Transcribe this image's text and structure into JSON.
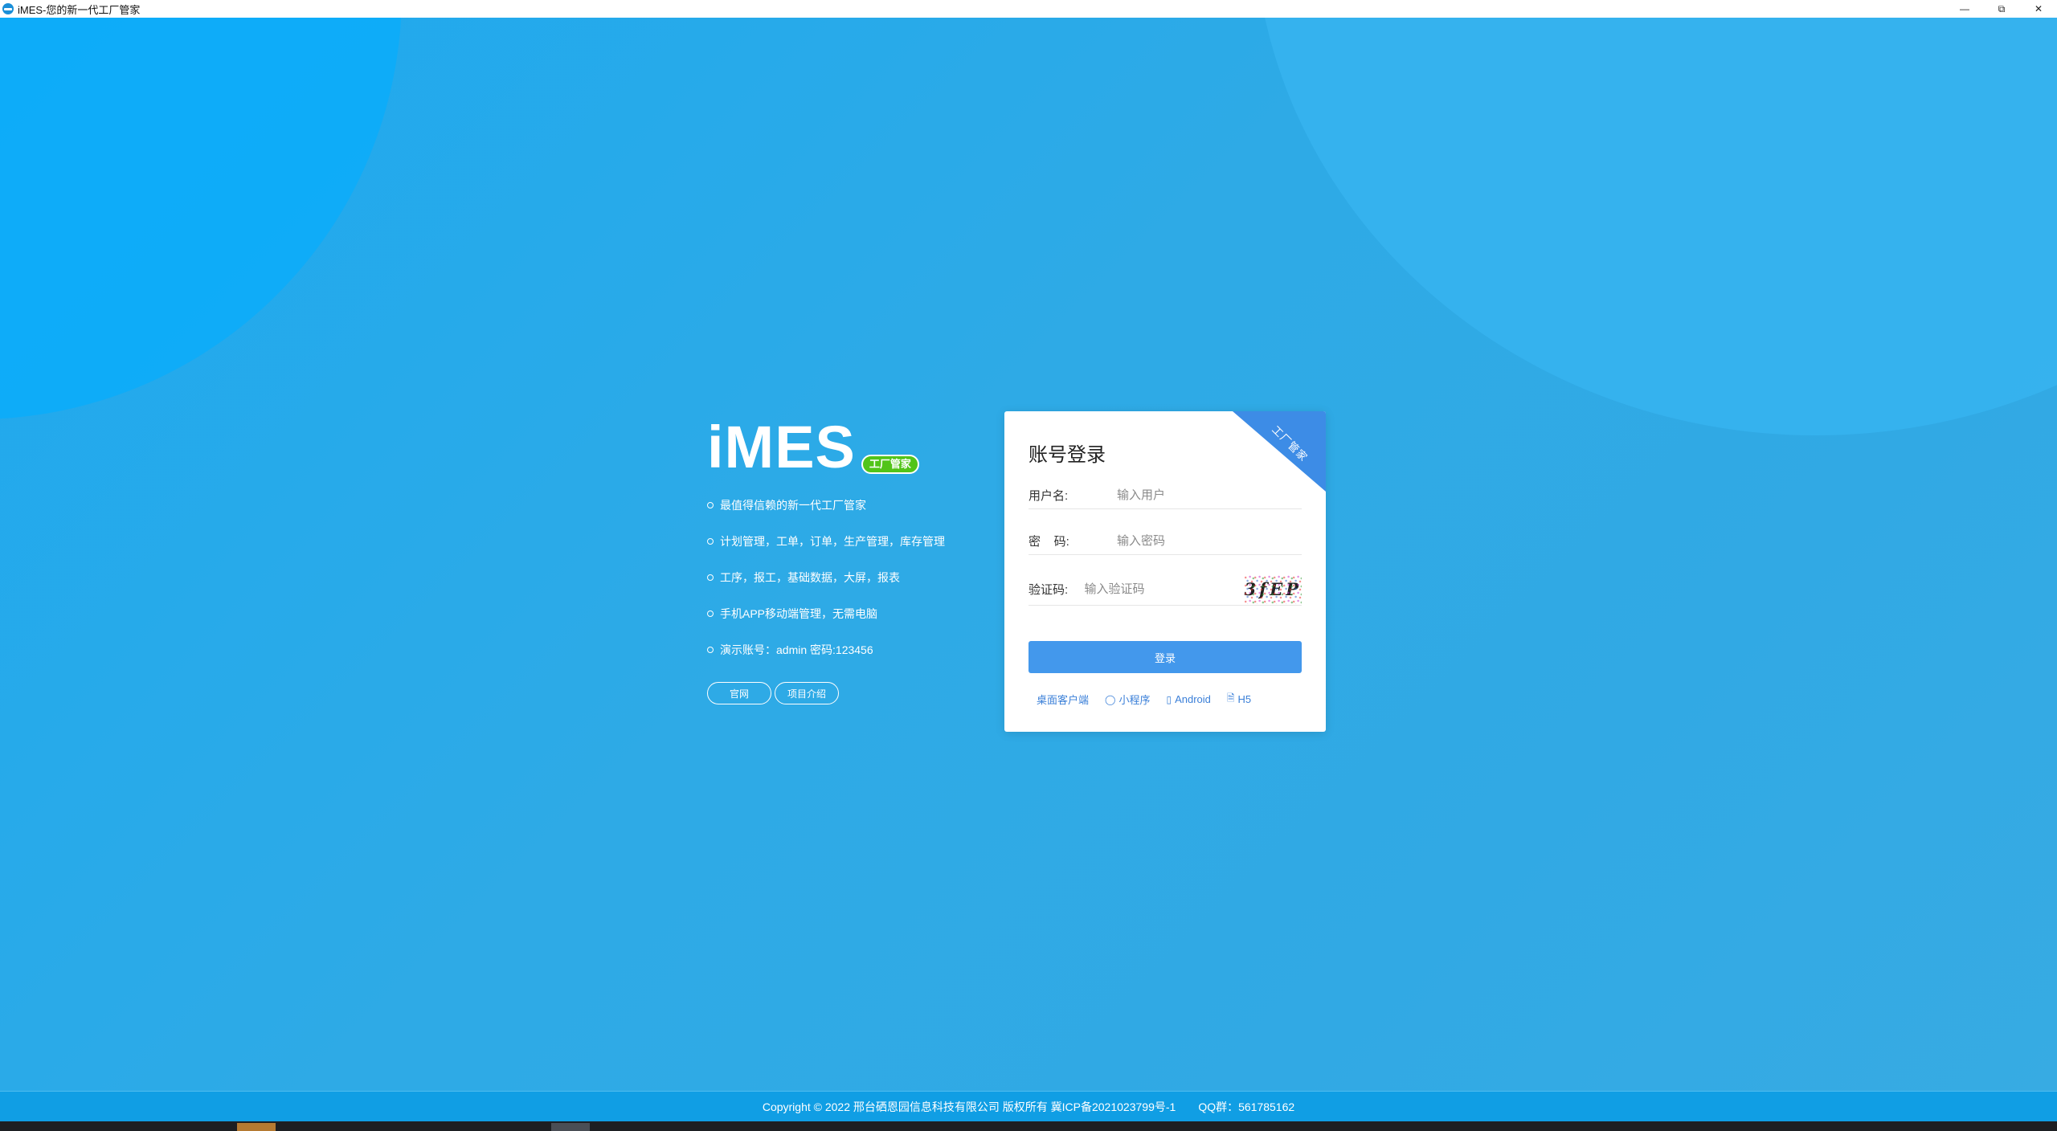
{
  "window": {
    "title": "iMES-您的新一代工厂管家",
    "controls": {
      "minimize": "—",
      "restore": "⧉",
      "close": "✕"
    }
  },
  "intro": {
    "brand": "iMES",
    "badge": "工厂管家",
    "features": [
      "最值得信赖的新一代工厂管家",
      "计划管理，工单，订单，生产管理，库存管理",
      "工序，报工，基础数据，大屏，报表",
      "手机APP移动端管理，无需电脑",
      "演示账号：admin 密码:123456"
    ],
    "links": {
      "home": "官网",
      "project": "项目介绍"
    }
  },
  "login": {
    "corner_badge": "工厂管家",
    "title": "账号登录",
    "username": {
      "label": "用户名:",
      "placeholder": "输入用户",
      "value": ""
    },
    "password": {
      "label": "密    码:",
      "placeholder": "输入密码",
      "value": ""
    },
    "captcha": {
      "label": "验证码:",
      "placeholder": "输入验证码",
      "value": "",
      "image_text": "3fEP"
    },
    "submit": "登录",
    "clients": [
      {
        "label": "桌面客户端",
        "icon": ""
      },
      {
        "label": "小程序",
        "icon": "chat-bubble-icon"
      },
      {
        "label": "Android",
        "icon": "mobile-phone-icon"
      },
      {
        "label": "H5",
        "icon": "document-icon"
      }
    ]
  },
  "footer": {
    "copyright": "Copyright © 2022 邢台硒恩园信息科技有限公司 版权所有 冀ICP备2021023799号-1",
    "qq": "QQ群：561785162"
  },
  "colors": {
    "background": "#2aa8e6",
    "primary_button": "#4398ec",
    "badge_green": "#52c41a",
    "corner_blue": "#3d8ce6",
    "link_blue": "#3a7fd8"
  }
}
